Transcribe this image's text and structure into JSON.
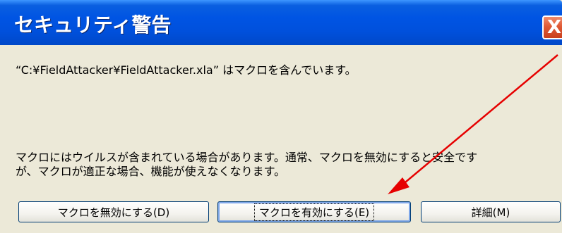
{
  "dialog": {
    "title": "セキュリティ警告",
    "close_label": "X",
    "file_message": "“C:¥FieldAttacker¥FieldAttacker.xla” はマクロを含んでいます。",
    "warning_line1": "マクロにはウイルスが含まれている場合があります。通常、マクロを無効にすると安全です",
    "warning_line2": "が、マクロが適正な場合、機能が使えなくなります。",
    "buttons": {
      "disable_macros": "マクロを無効にする(D)",
      "enable_macros": "マクロを有効にする(E)",
      "details": "詳細(M)"
    }
  },
  "annotation": {
    "arrow_color": "#e60000"
  }
}
